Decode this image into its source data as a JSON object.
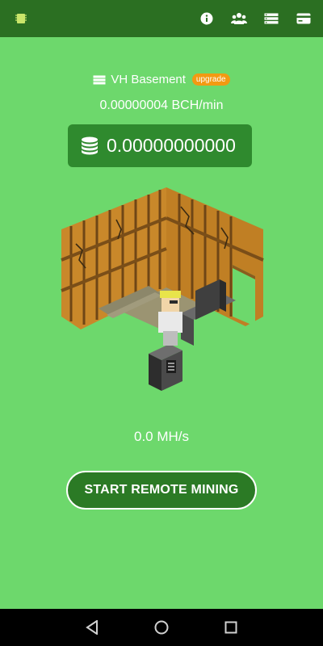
{
  "topbar": {
    "icons": [
      "chip-icon",
      "info-icon",
      "users-icon",
      "server-list-icon",
      "card-icon"
    ]
  },
  "location": {
    "name": "VH Basement",
    "badge": "upgrade"
  },
  "mining": {
    "rate": "0.00000004 BCH/min",
    "balance": "0.00000000000",
    "hashrate": "0.0 MH/s",
    "start_label": "START REMOTE MINING"
  },
  "colors": {
    "background": "#6dd86c",
    "topbar": "#2b6f22",
    "balance_box": "#2f8a2e",
    "button": "#2b7a25",
    "badge": "#f29a12"
  }
}
